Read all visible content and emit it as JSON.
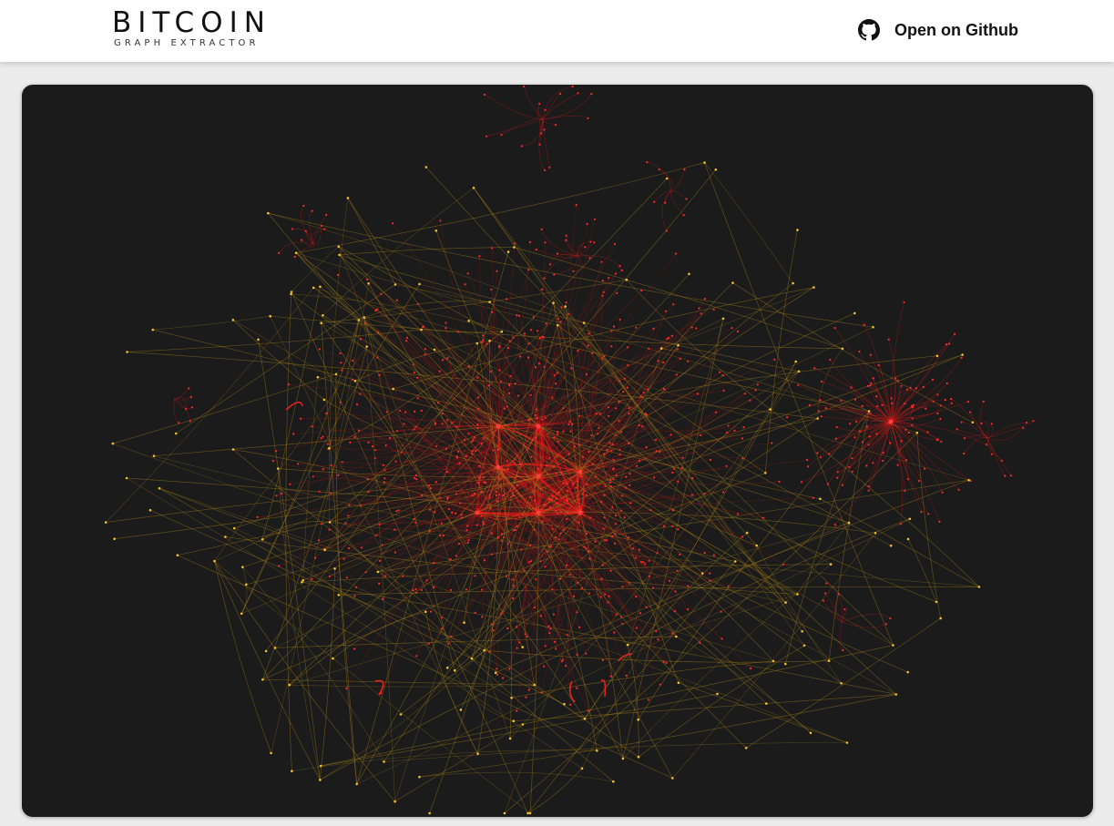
{
  "header": {
    "title": "BITCOIN",
    "subtitle": "GRAPH EXTRACTOR",
    "github_label": "Open on Github",
    "github_icon": "github-icon"
  },
  "graph": {
    "description_free": true,
    "colors": {
      "background": "#1b1b1b",
      "hub_edge": "#ff1a1a",
      "hub_node": "#ff2a2a",
      "peripheral_edge": "#b38a1a",
      "peripheral_node": "#f2c12e"
    }
  }
}
